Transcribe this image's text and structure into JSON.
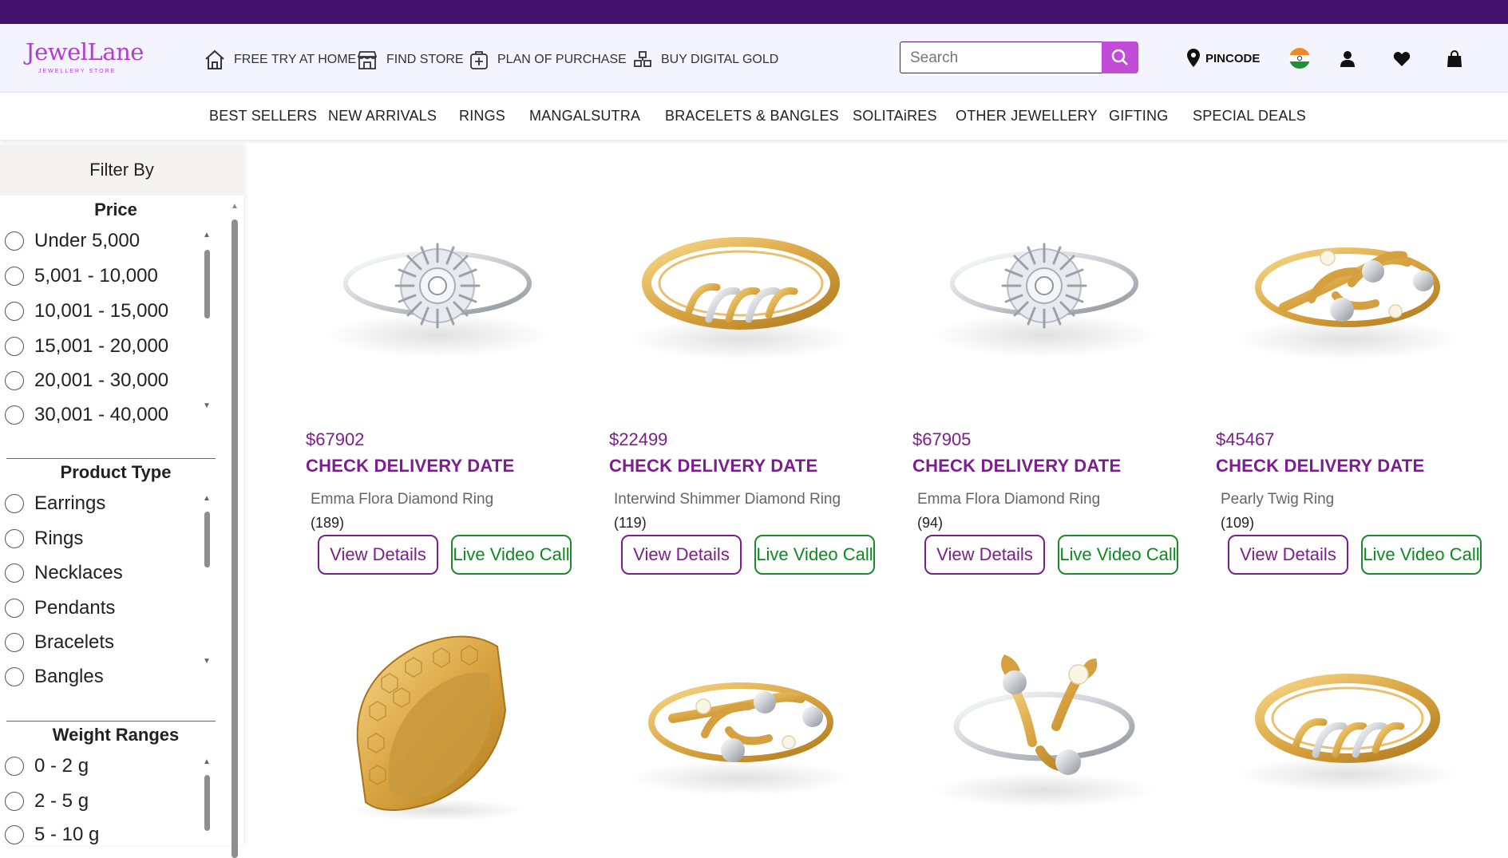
{
  "header": {
    "logo_main": "JewelLane",
    "logo_sub": "JEWELLERY STORE",
    "nav": [
      {
        "label": "FREE TRY AT HOME",
        "icon": "home-icon"
      },
      {
        "label": "FIND STORE",
        "icon": "store-icon"
      },
      {
        "label": "PLAN OF PURCHASE",
        "icon": "plan-icon"
      },
      {
        "label": "BUY DIGITAL GOLD",
        "icon": "gold-bars-icon"
      }
    ],
    "search_placeholder": "Search",
    "pincode_label": "PINCODE",
    "colors": {
      "topbar": "#42106a",
      "accent": "#c24bd8",
      "brand": "#7b1f8e"
    }
  },
  "categories": [
    "BEST SELLERS",
    "NEW ARRIVALS",
    "RINGS",
    "MANGALSUTRA",
    "BRACELETS & BANGLES",
    "SOLITAiRES",
    "OTHER JEWELLERY",
    "GIFTING",
    "SPECIAL DEALS"
  ],
  "filter": {
    "title": "Filter By",
    "sections": [
      {
        "title": "Price",
        "options": [
          "Under 5,000",
          "5,001 - 10,000",
          "10,001 - 15,000",
          "15,001 - 20,000",
          "20,001 - 30,000",
          "30,001 - 40,000"
        ]
      },
      {
        "title": "Product Type",
        "options": [
          "Earrings",
          "Rings",
          "Necklaces",
          "Pendants",
          "Bracelets",
          "Bangles"
        ]
      },
      {
        "title": "Weight Ranges",
        "options": [
          "0 - 2 g",
          "2 - 5 g",
          "5 - 10 g"
        ]
      }
    ]
  },
  "products": [
    {
      "price": "$67902",
      "cta": "CHECK DELIVERY DATE",
      "name": "Emma Flora Diamond Ring",
      "count": "(189)",
      "view": "View Details",
      "live": "Live Video Call",
      "image": "diamond-halo-ring"
    },
    {
      "price": "$22499",
      "cta": "CHECK DELIVERY DATE",
      "name": "Interwind Shimmer Diamond Ring",
      "count": "(119)",
      "view": "View Details",
      "live": "Live Video Call",
      "image": "gold-swirl-ring"
    },
    {
      "price": "$67905",
      "cta": "CHECK DELIVERY DATE",
      "name": "Emma Flora Diamond Ring",
      "count": "(94)",
      "view": "View Details",
      "live": "Live Video Call",
      "image": "diamond-halo-ring"
    },
    {
      "price": "$45467",
      "cta": "CHECK DELIVERY DATE",
      "name": "Pearly Twig Ring",
      "count": "(109)",
      "view": "View Details",
      "live": "Live Video Call",
      "image": "gold-twig-ring"
    },
    {
      "image": "gold-hexagon-band"
    },
    {
      "image": "gold-twig-ring"
    },
    {
      "image": "gold-floral-bypass-ring"
    },
    {
      "image": "gold-swirl-ring"
    }
  ]
}
